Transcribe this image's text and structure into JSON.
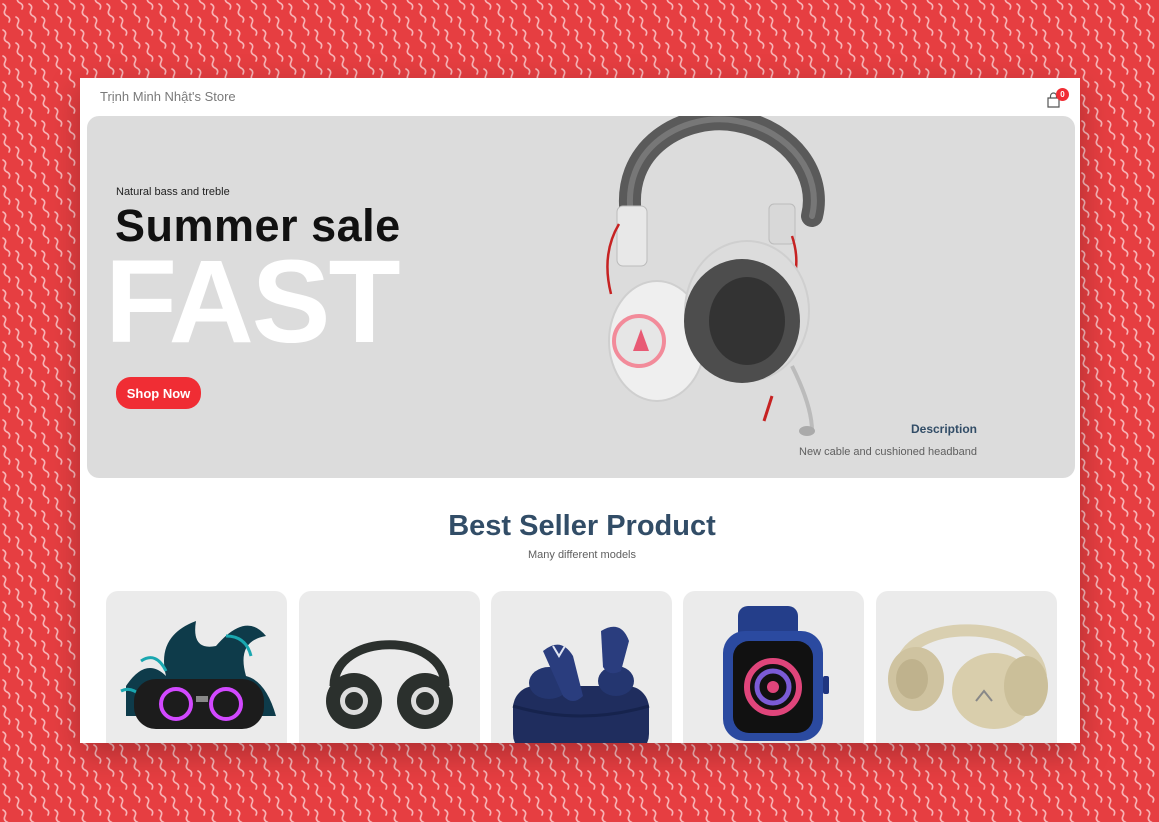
{
  "store": {
    "name": "Trịnh Minh Nhật's Store"
  },
  "cart": {
    "count": "0",
    "icon": "shopping-bag-icon"
  },
  "hero": {
    "small_text": "Natural bass and treble",
    "mid_text": "Summer sale",
    "large_text": "FAST",
    "button_label": "Shop Now",
    "description_title": "Description",
    "description_text": "New cable and cushioned headband",
    "image": "headphones-image"
  },
  "best_seller": {
    "title": "Best Seller Product",
    "subtitle": "Many different models",
    "products": [
      {
        "image": "speaker-image"
      },
      {
        "image": "headphones-black-image"
      },
      {
        "image": "earbuds-image"
      },
      {
        "image": "smartwatch-image"
      },
      {
        "image": "headphones-beige-image"
      }
    ]
  },
  "colors": {
    "background": "#e63e41",
    "accent": "#f02d34",
    "heading": "#324d67",
    "hero_bg": "#dcdcdc"
  }
}
